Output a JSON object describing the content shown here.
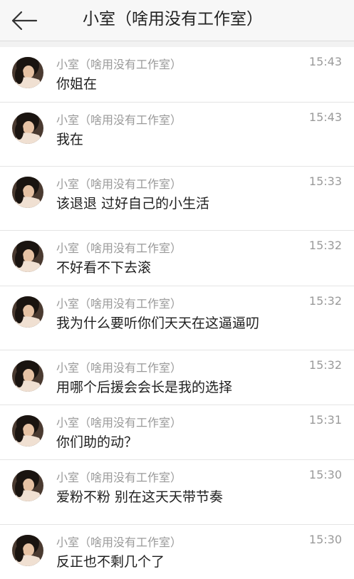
{
  "header": {
    "title": "小室（啥用没有工作室）"
  },
  "icons": {
    "back": "arrow-left-icon",
    "avatar": "user-avatar"
  },
  "colors": {
    "header_bg": "#f7f7f7",
    "list_bg": "#ffffff",
    "secondary_text": "#9a9a9a",
    "primary_text": "#1f1f1f"
  },
  "messages": [
    {
      "sender": "小室（啥用没有工作室）",
      "time": "15:43",
      "text": "你姐在"
    },
    {
      "sender": "小室（啥用没有工作室）",
      "time": "15:43",
      "text": "我在"
    },
    {
      "sender": "小室（啥用没有工作室）",
      "time": "15:33",
      "text": "该退退 过好自己的小生活"
    },
    {
      "sender": "小室（啥用没有工作室）",
      "time": "15:32",
      "text": "不好看不下去滚"
    },
    {
      "sender": "小室（啥用没有工作室）",
      "time": "15:32",
      "text": "我为什么要听你们天天在这逼逼叨"
    },
    {
      "sender": "小室（啥用没有工作室）",
      "time": "15:32",
      "text": "用哪个后援会会长是我的选择"
    },
    {
      "sender": "小室（啥用没有工作室）",
      "time": "15:31",
      "text": "你们助的动？"
    },
    {
      "sender": "小室（啥用没有工作室）",
      "time": "15:30",
      "text": "爱粉不粉 别在这天天带节奏"
    },
    {
      "sender": "小室（啥用没有工作室）",
      "time": "15:30",
      "text": "反正也不剩几个了"
    }
  ]
}
